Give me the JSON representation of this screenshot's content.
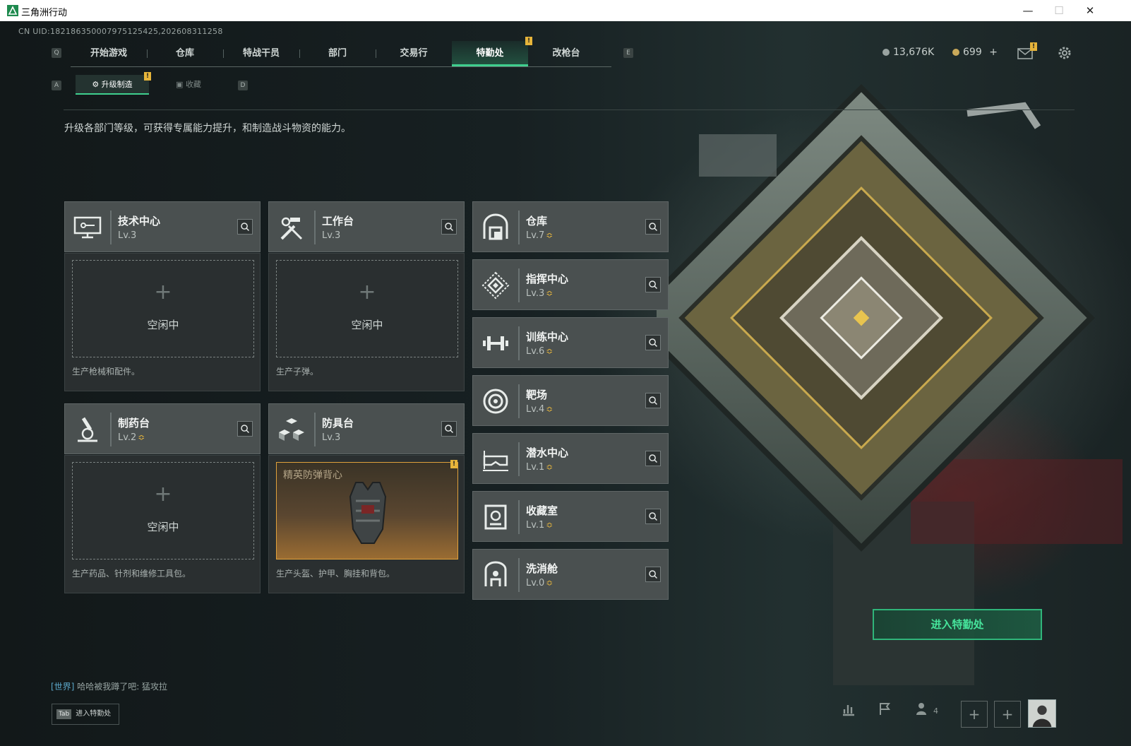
{
  "window": {
    "title": "三角洲行动",
    "minimize": "—",
    "maximize": "☐",
    "close": "✕"
  },
  "uid": "CN UID:18218635000797512542​5,202608311258",
  "nav": {
    "left_key": "Q",
    "right_key": "E",
    "tabs": [
      "开始游戏",
      "仓库",
      "特战干员",
      "部门",
      "交易行",
      "特勤处",
      "改枪台"
    ],
    "active": "特勤处",
    "badge": "!"
  },
  "currency": {
    "coins": "13,676K",
    "gold": "699",
    "gold_add": "+"
  },
  "subnav": {
    "left_key": "A",
    "right_key": "D",
    "tabs": [
      "升级制造",
      "收藏"
    ],
    "badge": "!"
  },
  "description": "升级各部门等级，可获得专属能力提升，和制造战斗物资的能力。",
  "workstations": [
    {
      "name": "技术中心",
      "level": "Lv.3",
      "upgrade": false,
      "slot_text": "空闲中",
      "desc": "生产枪械和配件。"
    },
    {
      "name": "工作台",
      "level": "Lv.3",
      "upgrade": false,
      "slot_text": "空闲中",
      "desc": "生产子弹。"
    },
    {
      "name": "制药台",
      "level": "Lv.2",
      "upgrade": true,
      "slot_text": "空闲中",
      "desc": "生产药品、针剂和维修工具包。"
    },
    {
      "name": "防具台",
      "level": "Lv.3",
      "upgrade": false,
      "crafting_item": "精英防弹背心",
      "badge": "!",
      "desc": "生产头盔、护甲、胸挂和背包。"
    }
  ],
  "departments": [
    {
      "name": "仓库",
      "level": "Lv.7",
      "upgrade": true
    },
    {
      "name": "指挥中心",
      "level": "Lv.3",
      "upgrade": true
    },
    {
      "name": "训练中心",
      "level": "Lv.6",
      "upgrade": true
    },
    {
      "name": "靶场",
      "level": "Lv.4",
      "upgrade": true
    },
    {
      "name": "潜水中心",
      "level": "Lv.1",
      "upgrade": true
    },
    {
      "name": "收藏室",
      "level": "Lv.1",
      "upgrade": true
    },
    {
      "name": "洗消舱",
      "level": "Lv.0",
      "upgrade": true
    }
  ],
  "upgrade_glyph": "≎",
  "plus_glyph": "+",
  "enter_button": "进入特勤处",
  "chat": {
    "channel": "[世界]",
    "message": "哈哈被我蹲了吧: 猛攻拉"
  },
  "tab_hint": {
    "key": "Tab",
    "label": "进入特勤处"
  },
  "party_count": "4",
  "colors": {
    "accent": "#3fcf8e",
    "badge": "#e6b43a",
    "upgrade": "#e0b13e"
  }
}
